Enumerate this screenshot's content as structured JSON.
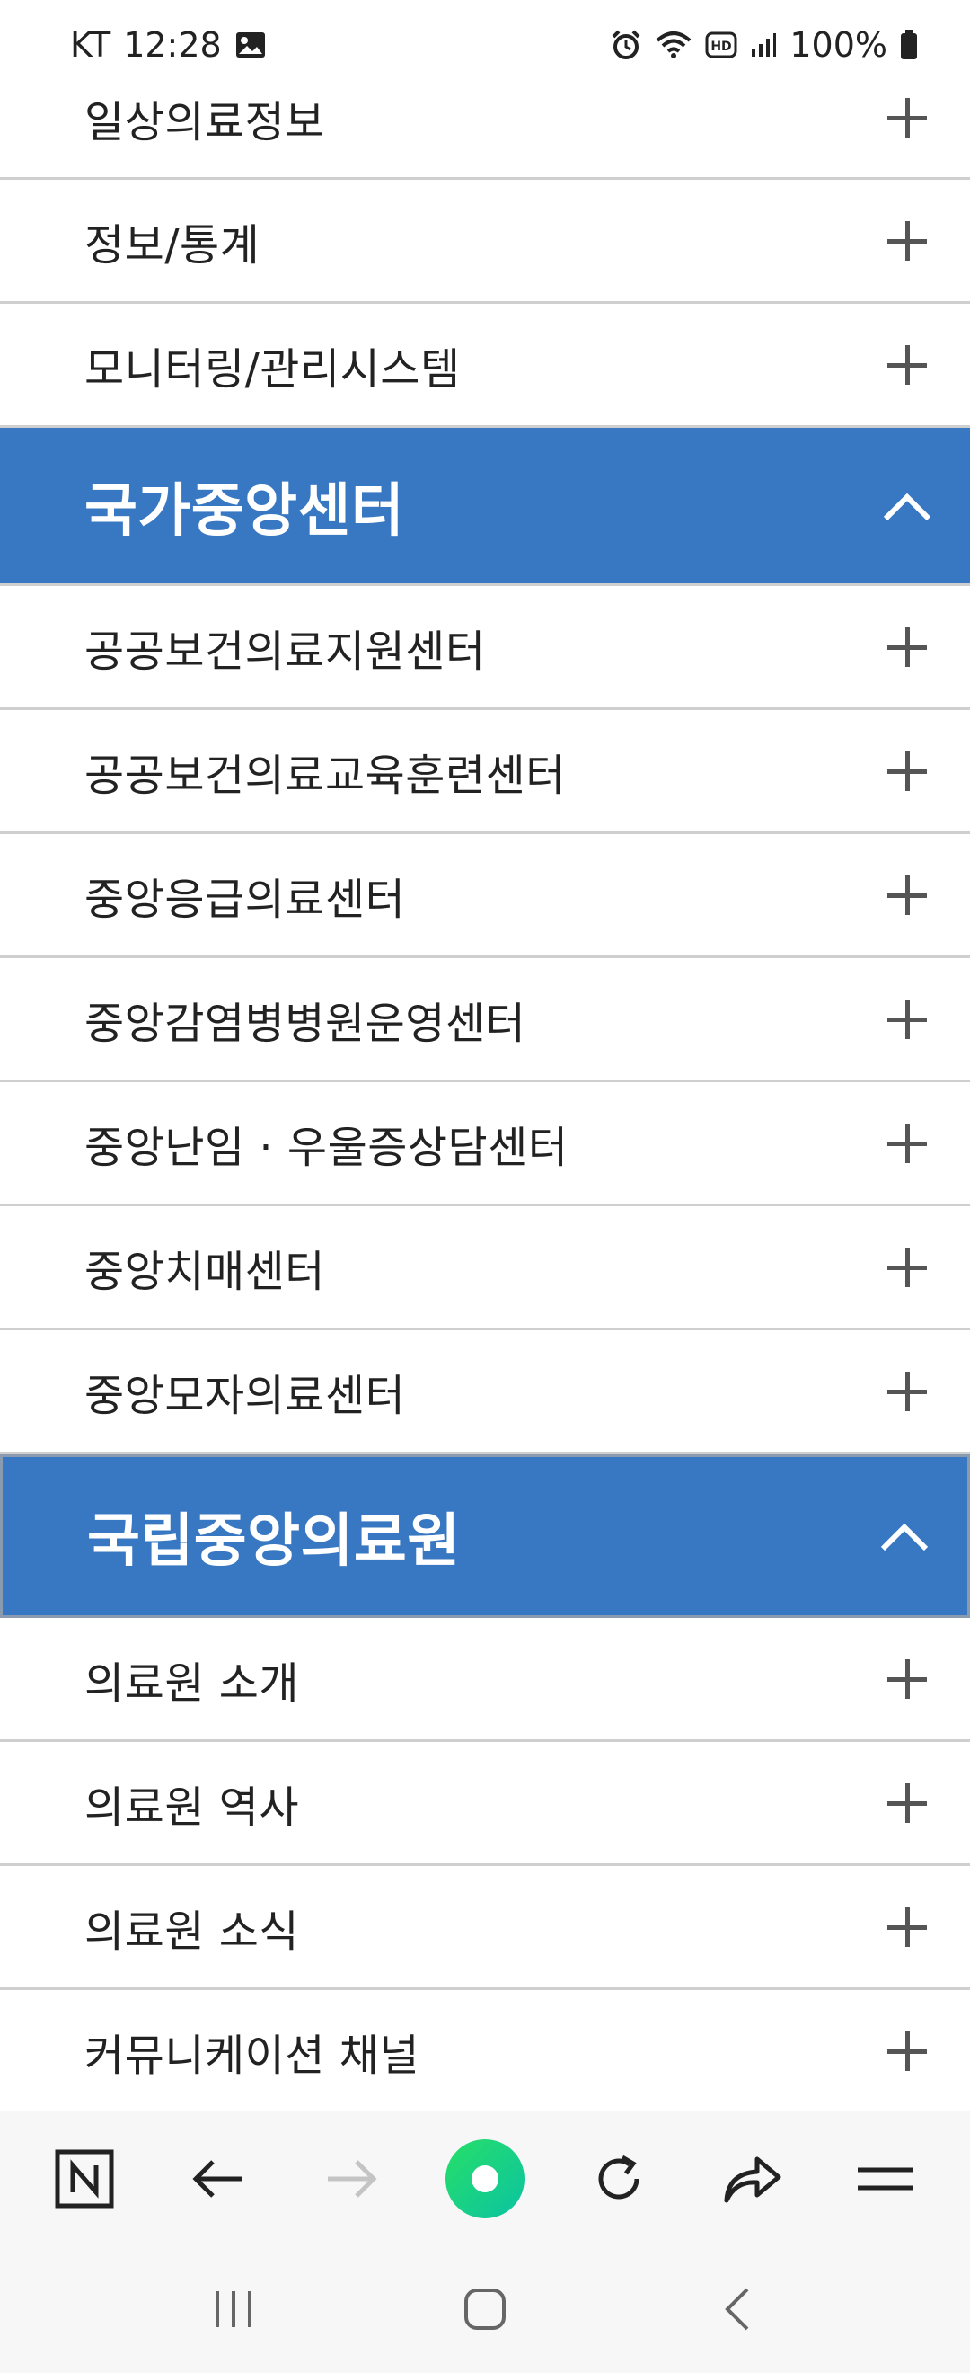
{
  "status_bar": {
    "carrier": "KT",
    "time": "12:28",
    "battery": "100%",
    "icons": [
      "gallery-icon",
      "alarm-icon",
      "wifi-icon",
      "hd-voice-icon",
      "signal-icon",
      "battery-icon"
    ]
  },
  "menu": {
    "top_items": [
      {
        "label": "일상의료정보"
      },
      {
        "label": "정보/통계"
      },
      {
        "label": "모니터링/관리시스템"
      }
    ],
    "section_national": {
      "title": "국가중앙센터",
      "items": [
        {
          "label": "공공보건의료지원센터"
        },
        {
          "label": "공공보건의료교육훈련센터"
        },
        {
          "label": "중앙응급의료센터"
        },
        {
          "label": "중앙감염병병원운영센터"
        },
        {
          "label": "중앙난임 · 우울증상담센터"
        },
        {
          "label": "중앙치매센터"
        },
        {
          "label": "중앙모자의료센터"
        }
      ]
    },
    "section_nmc": {
      "title": "국립중앙의료원",
      "items": [
        {
          "label": "의료원 소개"
        },
        {
          "label": "의료원 역사"
        },
        {
          "label": "의료원 소식"
        },
        {
          "label": "커뮤니케이션 채널"
        }
      ]
    }
  },
  "toolbar": {
    "icons": [
      "naver-home-icon",
      "back-arrow-icon",
      "forward-arrow-icon",
      "green-dot-icon",
      "refresh-icon",
      "share-icon",
      "menu-icon"
    ]
  },
  "system_nav": {
    "icons": [
      "recent-apps-icon",
      "home-icon",
      "back-icon"
    ]
  },
  "colors": {
    "section_bg": "#3878c2",
    "divider": "#cfcfcf",
    "accent_green": "#19d37d"
  }
}
